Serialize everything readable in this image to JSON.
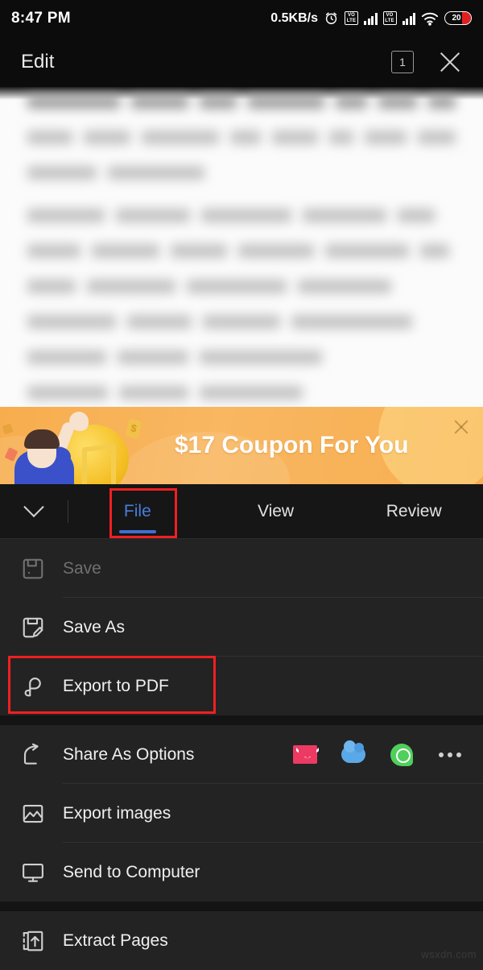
{
  "statusbar": {
    "time": "8:47 PM",
    "network_speed": "0.5KB/s",
    "alarm_icon": "alarm-clock-icon",
    "volte1_label": "VO\nLTE",
    "volte1_top": "VO",
    "volte1_bottom": "LTE",
    "volte2_top": "VO",
    "volte2_bottom": "LTE",
    "wifi_icon": "wifi-icon",
    "battery_percent": "20"
  },
  "titlebar": {
    "title": "Edit",
    "tab_count": "1",
    "close_icon": "close-icon"
  },
  "coupon": {
    "title": "$17 Coupon For You",
    "close_icon": "close-icon",
    "bg_color": "#f7ad4e",
    "text_color": "#ffffff",
    "confetti_symbol": "$"
  },
  "tabbar": {
    "collapse_icon": "chevron-down-icon",
    "tabs": [
      {
        "label": "File",
        "active": true
      },
      {
        "label": "View",
        "active": false
      },
      {
        "label": "Review",
        "active": false
      }
    ],
    "active_color": "#4a7ddb",
    "highlight_color": "#ef2020"
  },
  "menu": {
    "items": [
      {
        "label": "Save",
        "icon": "save-disk-icon",
        "disabled": true
      },
      {
        "label": "Save As",
        "icon": "save-as-disk-icon",
        "disabled": false
      },
      {
        "label": "Export to PDF",
        "icon": "pdf-icon",
        "disabled": false,
        "highlighted": true
      },
      {
        "label": "Share As Options",
        "icon": "share-arrow-icon",
        "disabled": false
      },
      {
        "label": "Export images",
        "icon": "image-icon",
        "disabled": false
      },
      {
        "label": "Send to Computer",
        "icon": "monitor-icon",
        "disabled": false
      },
      {
        "label": "Extract Pages",
        "icon": "extract-pages-icon",
        "disabled": false
      }
    ],
    "share_targets": [
      {
        "name": "email-icon",
        "color": "#ec3a63"
      },
      {
        "name": "cloud-icon",
        "color": "#5ba8e8"
      },
      {
        "name": "whatsapp-icon",
        "color": "#4fcf5c"
      },
      {
        "name": "more-options-icon",
        "color": "#cfcfcf"
      }
    ]
  },
  "document": {
    "content_state": "blurred-text"
  },
  "watermark": "wsxdn.com"
}
